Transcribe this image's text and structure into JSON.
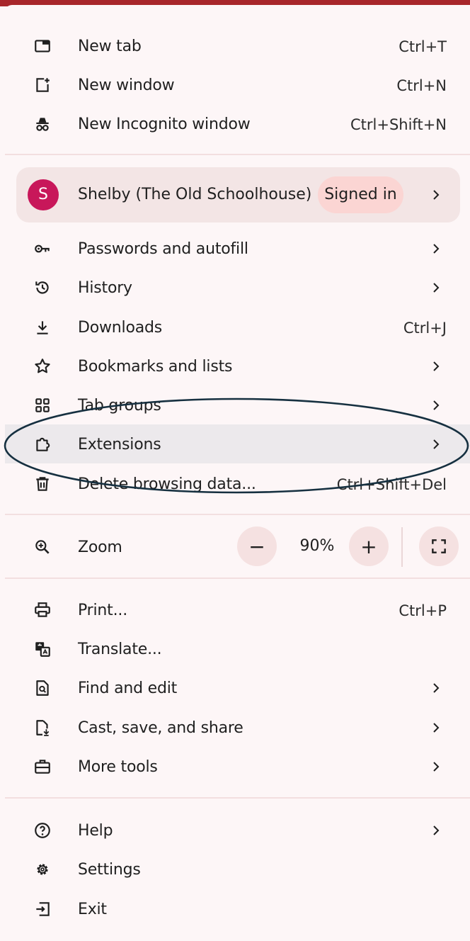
{
  "menu": {
    "top": [
      {
        "label": "New tab",
        "shortcut": "Ctrl+T",
        "icon": "new-tab-icon"
      },
      {
        "label": "New window",
        "shortcut": "Ctrl+N",
        "icon": "new-window-icon"
      },
      {
        "label": "New Incognito window",
        "shortcut": "Ctrl+Shift+N",
        "icon": "incognito-icon"
      }
    ],
    "profile": {
      "initial": "S",
      "name": "Shelby (The Old Schoolhouse)",
      "status": "Signed in",
      "avatar_color": "#c8175a"
    },
    "middle": [
      {
        "label": "Passwords and autofill",
        "icon": "key-icon"
      },
      {
        "label": "History",
        "icon": "history-icon"
      },
      {
        "label": "Downloads",
        "shortcut": "Ctrl+J",
        "icon": "download-icon"
      },
      {
        "label": "Bookmarks and lists",
        "icon": "star-icon"
      },
      {
        "label": "Tab groups",
        "icon": "tab-groups-icon"
      },
      {
        "label": "Extensions",
        "icon": "puzzle-icon"
      },
      {
        "label": "Delete browsing data...",
        "shortcut": "Ctrl+Shift+Del",
        "icon": "trash-icon"
      }
    ],
    "zoom": {
      "label": "Zoom",
      "value": "90%",
      "minus": "−",
      "plus": "+",
      "icon": "zoom-icon"
    },
    "tools": [
      {
        "label": "Print...",
        "shortcut": "Ctrl+P",
        "icon": "print-icon"
      },
      {
        "label": "Translate...",
        "icon": "translate-icon"
      },
      {
        "label": "Find and edit",
        "icon": "find-icon"
      },
      {
        "label": "Cast, save, and share",
        "icon": "cast-icon"
      },
      {
        "label": "More tools",
        "icon": "toolbox-icon"
      }
    ],
    "bottom": [
      {
        "label": "Help",
        "icon": "help-icon"
      },
      {
        "label": "Settings",
        "icon": "gear-icon"
      },
      {
        "label": "Exit",
        "icon": "exit-icon"
      }
    ]
  },
  "colors": {
    "menu_background": "#fdf6f7",
    "profile_background": "#f3e5e5",
    "signed_in_badge": "#fbd5d3",
    "hover_highlight": "#ece9ec",
    "annotation_oval": "#163040",
    "browser_frame": "#a8262b"
  }
}
